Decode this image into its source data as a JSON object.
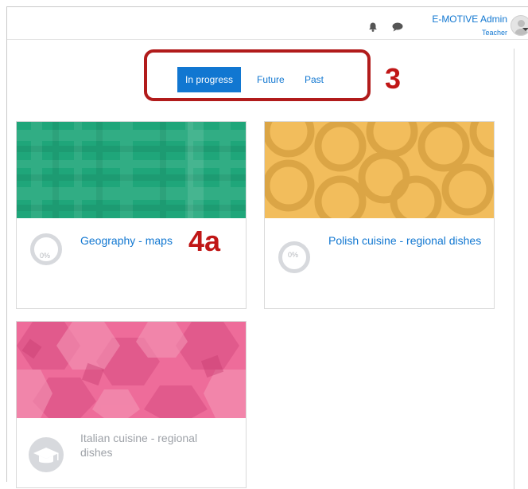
{
  "header": {
    "user_name": "E-MOTIVE Admin",
    "user_role": "Teacher"
  },
  "tabs": [
    {
      "label": "In progress",
      "active": true
    },
    {
      "label": "Future",
      "active": false
    },
    {
      "label": "Past",
      "active": false
    }
  ],
  "annotations": {
    "tabs_marker": "3",
    "course_marker": "4a",
    "color": "#c01616"
  },
  "courses": [
    {
      "title": "Geography - maps",
      "progress": "0%",
      "pattern": "plaid-green",
      "color": "#1fa67a"
    },
    {
      "title": "Polish cuisine - regional dishes",
      "progress": "0%",
      "pattern": "circles-orange",
      "color": "#f2bd5c"
    },
    {
      "title": "Italian cuisine - regional dishes",
      "progress": null,
      "pattern": "hexagons-pink",
      "color": "#ee6c9a"
    }
  ],
  "colors": {
    "accent": "#1177d1",
    "highlight_border": "#b11b1b"
  }
}
